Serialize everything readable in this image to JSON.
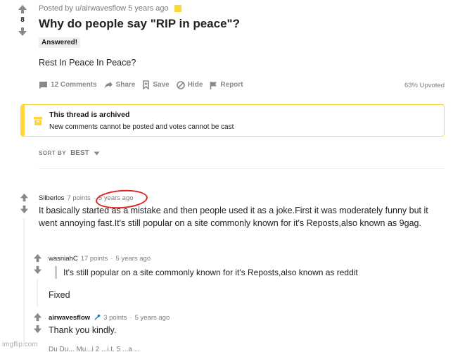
{
  "post": {
    "author_line": "Posted by u/airwavesflow 5 years ago",
    "score": "8",
    "title": "Why do people say \"RIP in peace\"?",
    "flair": "Answered!",
    "body": "Rest In Peace In Peace?",
    "actions": {
      "comments": "12 Comments",
      "share": "Share",
      "save": "Save",
      "hide": "Hide",
      "report": "Report"
    },
    "upvoted": "63% Upvoted"
  },
  "archived": {
    "title": "This thread is archived",
    "subtitle": "New comments cannot be posted and votes cannot be cast"
  },
  "sort": {
    "label": "SORT BY",
    "value": "BEST"
  },
  "comments": [
    {
      "author": "Silberlos",
      "points": "7 points",
      "sep": "·",
      "time": "5 years ago",
      "text": "It basically started as a mistake and then people used it as a joke.First it was moderately funny but it went annoying fast.It's still popular on a site commonly known for it's Reposts,also known as 9gag."
    },
    {
      "author": "wasniahC",
      "points": "17 points",
      "sep": "·",
      "time": "5 years ago",
      "quote": "It's still popular on a site commonly known for it's Reposts,also known as reddit",
      "text": "Fixed"
    },
    {
      "author": "airwavesflow",
      "points": "3 points",
      "sep": "·",
      "time": "5 years ago",
      "text": "Thank you kindly."
    }
  ],
  "cutoff_text": "Du Du... Mu...i 2 ...i.t. 5 ...a ...",
  "watermark": "imgflip.com",
  "colors": {
    "archive_yellow": "#ffd635",
    "circle_red": "#e02222",
    "op_blue": "#0079d3",
    "meta_gray": "#7c7c7c"
  }
}
